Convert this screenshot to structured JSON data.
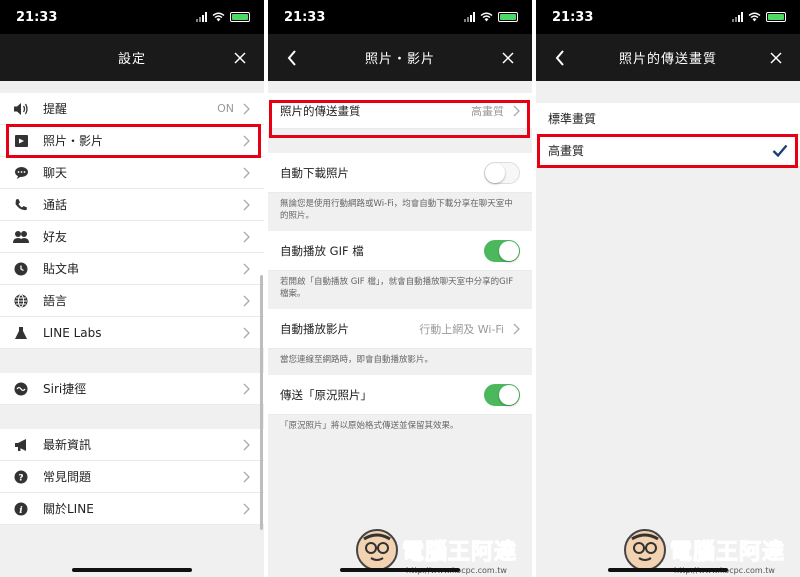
{
  "status": {
    "time": "21:33"
  },
  "panel1": {
    "title": "設定",
    "items": [
      {
        "label": "提醒",
        "value": "ON"
      },
      {
        "label": "照片・影片"
      },
      {
        "label": "聊天"
      },
      {
        "label": "通話"
      },
      {
        "label": "好友"
      },
      {
        "label": "貼文串"
      },
      {
        "label": "語言"
      },
      {
        "label": "LINE Labs"
      }
    ],
    "items2": [
      {
        "label": "Siri捷徑"
      }
    ],
    "items3": [
      {
        "label": "最新資訊"
      },
      {
        "label": "常見問題"
      },
      {
        "label": "關於LINE"
      }
    ]
  },
  "panel2": {
    "title": "照片・影片",
    "quality_label": "照片的傳送畫質",
    "quality_value": "高畫質",
    "auto_download_label": "自動下載照片",
    "auto_download_on": false,
    "auto_download_desc": "無論您是使用行動網路或Wi-Fi，均會自動下載分享在聊天室中的照片。",
    "gif_label": "自動播放 GIF 檔",
    "gif_on": true,
    "gif_desc": "若開啟「自動播放 GIF 檔」，就會自動播放聊天室中分享的GIF檔案。",
    "video_label": "自動播放影片",
    "video_value": "行動上網及 Wi-Fi",
    "video_desc": "當您連線至網路時，即會自動播放影片。",
    "live_label": "傳送「原況照片」",
    "live_on": true,
    "live_desc": "「原況照片」將以原始格式傳送並保留其效果。"
  },
  "panel3": {
    "title": "照片的傳送畫質",
    "option_standard": "標準畫質",
    "option_high": "高畫質"
  },
  "watermark": {
    "text": "電腦王阿達",
    "url": "http://www.kocpc.com.tw"
  },
  "colors": {
    "highlight": "#e60012",
    "toggle_on": "#4cb85c",
    "check": "#1a3d73"
  }
}
